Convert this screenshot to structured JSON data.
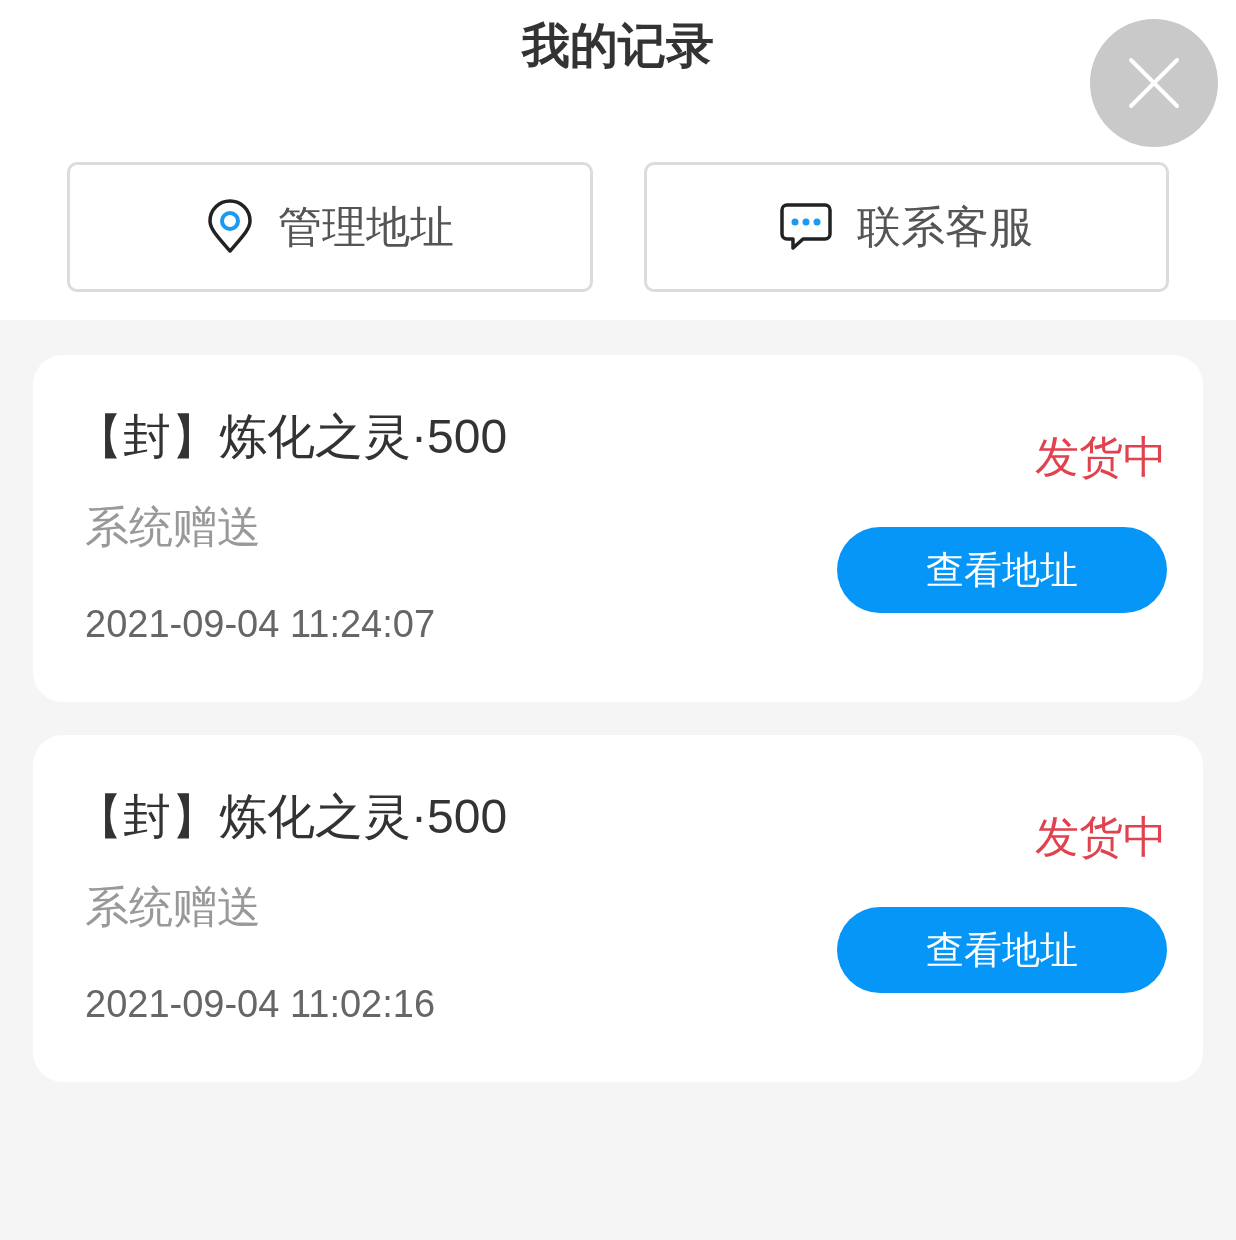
{
  "header": {
    "title": "我的记录"
  },
  "actions": [
    {
      "kind": "location",
      "label": "管理地址"
    },
    {
      "kind": "chat",
      "label": "联系客服"
    }
  ],
  "records": [
    {
      "title": "【封】炼化之灵·500",
      "status": "发货中",
      "source": "系统赠送",
      "time": "2021-09-04 11:24:07",
      "button": "查看地址"
    },
    {
      "title": "【封】炼化之灵·500",
      "status": "发货中",
      "source": "系统赠送",
      "time": "2021-09-04 11:02:16",
      "button": "查看地址"
    }
  ]
}
